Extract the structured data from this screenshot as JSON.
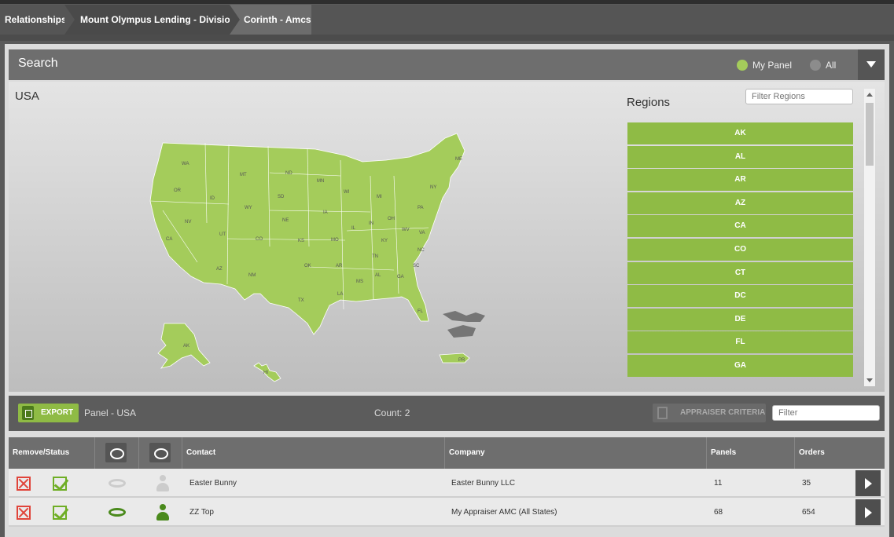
{
  "breadcrumbs": [
    {
      "label": "Relationships"
    },
    {
      "label": "Mount Olympus Lending - Divisions"
    },
    {
      "label": "Corinth - Amcs"
    }
  ],
  "search": {
    "title": "Search",
    "options": [
      {
        "label": "My Panel",
        "selected": true
      },
      {
        "label": "All",
        "selected": false
      }
    ]
  },
  "map": {
    "title": "USA",
    "fill_color": "#a4cc5b",
    "state_labels": [
      "WA",
      "OR",
      "CA",
      "NV",
      "ID",
      "MT",
      "WY",
      "UT",
      "AZ",
      "CO",
      "NM",
      "ND",
      "SD",
      "NE",
      "KS",
      "OK",
      "TX",
      "MN",
      "IA",
      "MO",
      "AR",
      "LA",
      "WI",
      "IL",
      "MI",
      "IN",
      "OH",
      "KY",
      "TN",
      "MS",
      "AL",
      "GA",
      "FL",
      "SC",
      "NC",
      "VA",
      "WV",
      "PA",
      "NY",
      "ME",
      "AK",
      "HI",
      "PR"
    ]
  },
  "regions": {
    "title": "Regions",
    "filter_placeholder": "Filter Regions",
    "items": [
      "AK",
      "AL",
      "AR",
      "AZ",
      "CA",
      "CO",
      "CT",
      "DC",
      "DE",
      "FL",
      "GA"
    ]
  },
  "toolbar": {
    "export_label": "EXPORT",
    "panel_label": "Panel - USA",
    "count_label": "Count: 2",
    "criteria_label": "APPRAISER CRITERIA",
    "filter_placeholder": "Filter"
  },
  "grid": {
    "headers": {
      "status": "Remove/Status",
      "contact": "Contact",
      "company": "Company",
      "panels": "Panels",
      "orders": "Orders"
    },
    "rows": [
      {
        "contact": "Easter Bunny",
        "company": "Easter Bunny LLC",
        "panels": "11",
        "orders": "35",
        "active": false
      },
      {
        "contact": "ZZ Top",
        "company": "My Appraiser AMC (All States)",
        "panels": "68",
        "orders": "654",
        "active": true
      }
    ]
  }
}
